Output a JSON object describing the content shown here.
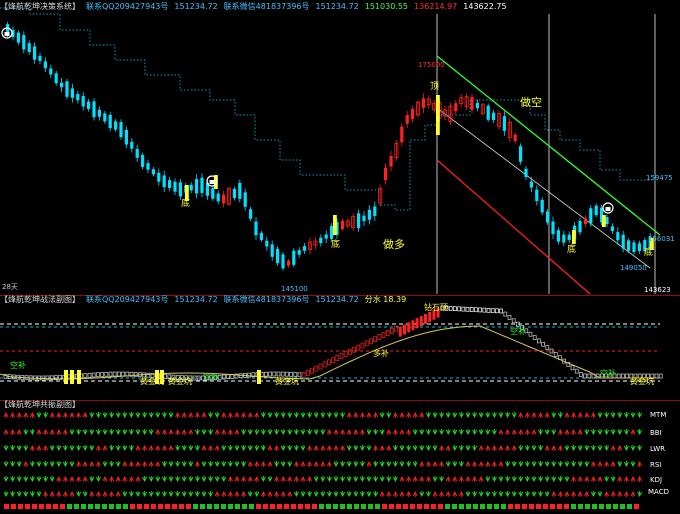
{
  "top": {
    "title": "【烽航乾坤决策系统】",
    "values": [
      {
        "text": "联系QQ209427943号",
        "color": "#40c0ff"
      },
      {
        "text": "151234.72",
        "color": "#40c0ff"
      },
      {
        "text": "联系微信481837396号",
        "color": "#40c0ff"
      },
      {
        "text": "151234.72",
        "color": "#40c0ff"
      },
      {
        "text": "151030.55",
        "color": "#40ff40"
      },
      {
        "text": "136214.97",
        "color": "#ff3030"
      },
      {
        "text": "143622.75",
        "color": "#ffffff"
      }
    ],
    "labels": {
      "peak_price": "175000",
      "low_price": "145100",
      "right_high": "159475",
      "right_mid": "156031",
      "right_low": "149050",
      "right_last": "143623",
      "days": "28天",
      "top_marker": "顶",
      "bottom_marker": "底",
      "short_label": "做空",
      "long_label": "做多"
    }
  },
  "middle": {
    "title": "【烽航乾坤战法副图】",
    "values": [
      {
        "text": "联系QQ209427943号",
        "color": "#40c0ff"
      },
      {
        "text": "151234.72",
        "color": "#40c0ff"
      },
      {
        "text": "联系微信481837396号",
        "color": "#40c0ff"
      },
      {
        "text": "151234.72",
        "color": "#40c0ff"
      },
      {
        "text": "分水 18.39",
        "color": "#ffff40"
      }
    ],
    "labels": {
      "diamond_top": "钻石顶",
      "short_term": "空补",
      "long_term": "多补",
      "gold_pit": "黄金坑"
    }
  },
  "bottom": {
    "title": "【烽航乾坤共振副图】",
    "rows": [
      "MTM",
      "BBI",
      "LWR",
      "RSI",
      "KDJ",
      "MACD"
    ]
  },
  "colors": {
    "up": "#ff2020",
    "down": "#00e0ff",
    "highlight": "#ffff30",
    "channel_green": "#30ff30",
    "channel_red": "#ff2020",
    "dotted": "#00a0c0"
  }
}
